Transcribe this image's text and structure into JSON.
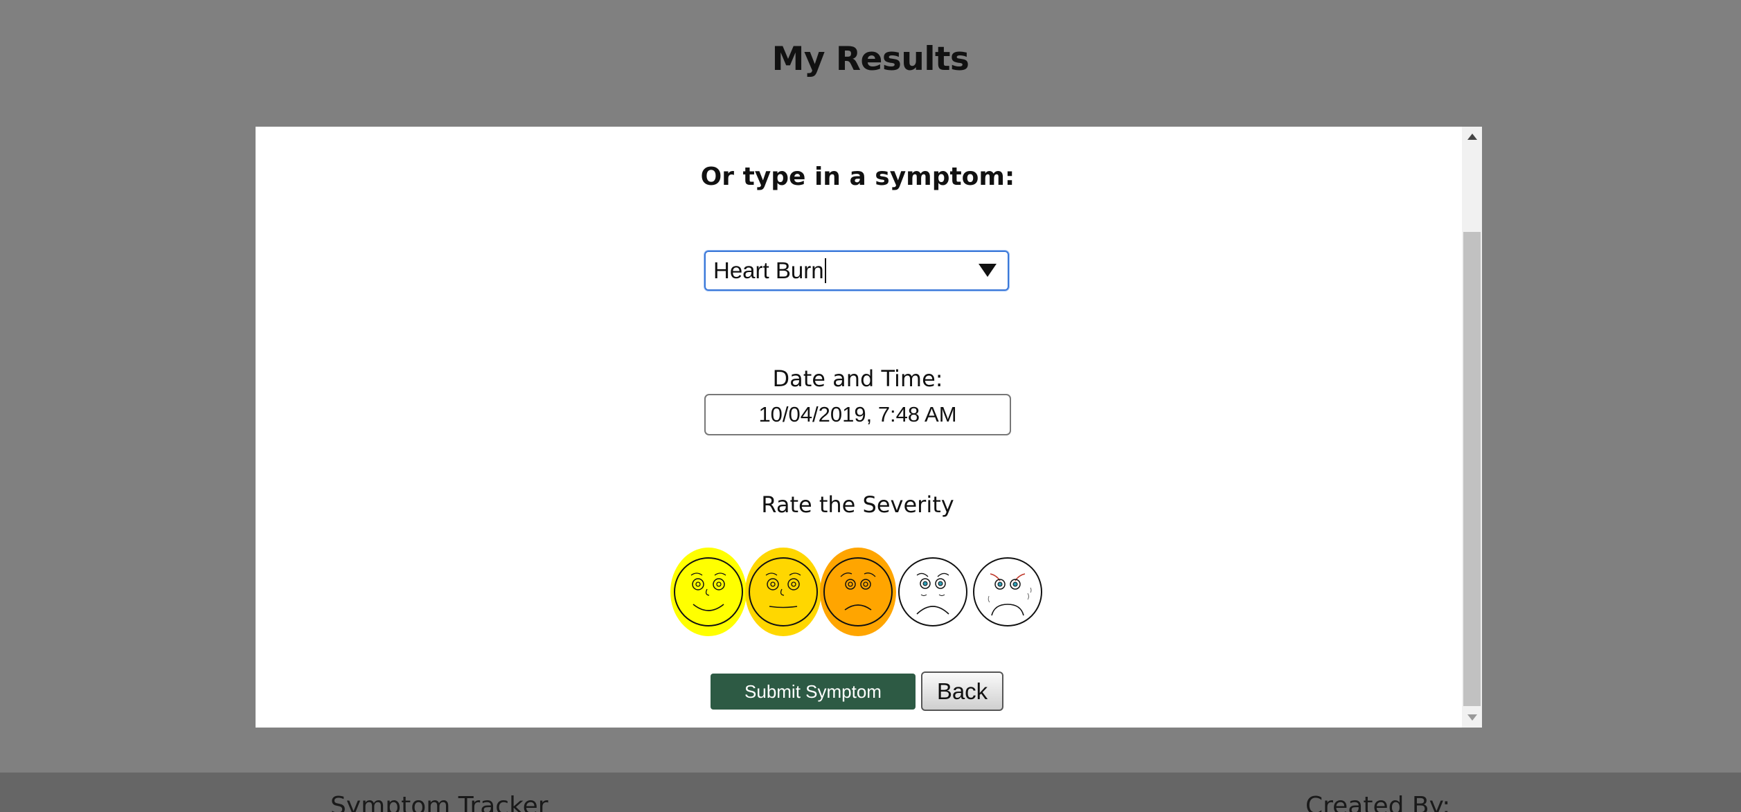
{
  "page": {
    "title": "My Results"
  },
  "modal": {
    "heading": "Or type in a symptom:",
    "symptom_select": {
      "value": "Heart Burn"
    },
    "date_label": "Date and Time:",
    "date_value": "10/04/2019, 7:48 AM",
    "severity_label": "Rate the Severity",
    "severity": {
      "options": [
        {
          "name": "severity-1",
          "fill": "#ffff00",
          "selected": true
        },
        {
          "name": "severity-2",
          "fill": "#ffd700",
          "selected": true
        },
        {
          "name": "severity-3",
          "fill": "#ffa500",
          "selected": true
        },
        {
          "name": "severity-4",
          "fill": "#ffffff",
          "selected": false
        },
        {
          "name": "severity-5",
          "fill": "#ffffff",
          "selected": false
        }
      ],
      "selected_level": 3
    },
    "submit_label": "Submit Symptom",
    "back_label": "Back"
  },
  "footer": {
    "left_text": "Symptom Tracker",
    "right_text": "Created By:"
  },
  "colors": {
    "background": "#808080",
    "submit_button": "#2d5a44",
    "focus_border": "#3b78d8",
    "footer": "#666666"
  }
}
